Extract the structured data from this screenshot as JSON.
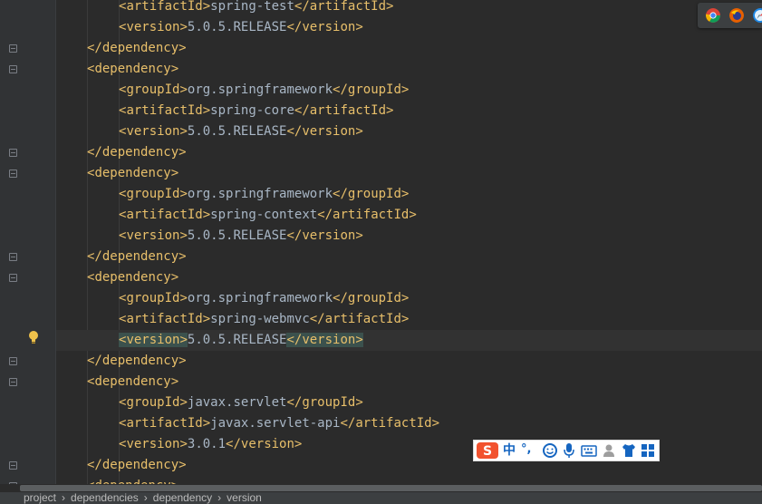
{
  "editor": {
    "lines": [
      {
        "indent": 2,
        "open": "artifactId",
        "text": "spring-test",
        "close": "artifactId"
      },
      {
        "indent": 2,
        "open": "version",
        "text": "5.0.5.RELEASE",
        "close": "version"
      },
      {
        "indent": 1,
        "close_only": "dependency"
      },
      {
        "indent": 1,
        "open_only": "dependency"
      },
      {
        "indent": 2,
        "open": "groupId",
        "text": "org.springframework",
        "close": "groupId"
      },
      {
        "indent": 2,
        "open": "artifactId",
        "text": "spring-core",
        "close": "artifactId"
      },
      {
        "indent": 2,
        "open": "version",
        "text": "5.0.5.RELEASE",
        "close": "version"
      },
      {
        "indent": 1,
        "close_only": "dependency"
      },
      {
        "indent": 1,
        "open_only": "dependency"
      },
      {
        "indent": 2,
        "open": "groupId",
        "text": "org.springframework",
        "close": "groupId"
      },
      {
        "indent": 2,
        "open": "artifactId",
        "text": "spring-context",
        "close": "artifactId"
      },
      {
        "indent": 2,
        "open": "version",
        "text": "5.0.5.RELEASE",
        "close": "version"
      },
      {
        "indent": 1,
        "close_only": "dependency"
      },
      {
        "indent": 1,
        "open_only": "dependency"
      },
      {
        "indent": 2,
        "open": "groupId",
        "text": "org.springframework",
        "close": "groupId"
      },
      {
        "indent": 2,
        "open": "artifactId",
        "text": "spring-webmvc",
        "close": "artifactId"
      },
      {
        "indent": 2,
        "open": "version",
        "text": "5.0.5.RELEASE",
        "close": "version",
        "current": true
      },
      {
        "indent": 1,
        "close_only": "dependency"
      },
      {
        "indent": 1,
        "open_only": "dependency"
      },
      {
        "indent": 2,
        "open": "groupId",
        "text": "javax.servlet",
        "close": "groupId"
      },
      {
        "indent": 2,
        "open": "artifactId",
        "text": "javax.servlet-api",
        "close": "artifactId"
      },
      {
        "indent": 2,
        "open": "version",
        "text": "3.0.1",
        "close": "version"
      },
      {
        "indent": 1,
        "close_only": "dependency"
      },
      {
        "indent": 1,
        "open_only": "dependency"
      }
    ]
  },
  "breadcrumb": [
    "project",
    "dependencies",
    "dependency",
    "version"
  ],
  "breadcrumb_separator": "›",
  "browser_icons": [
    "chrome-icon",
    "firefox-icon",
    "safari-icon"
  ],
  "ime_toolbar": {
    "items": [
      "sogou-logo-icon",
      "中",
      "°,",
      "emoji-icon",
      "microphone-icon",
      "keyboard-icon",
      "user-icon",
      "shirt-icon",
      "grid-icon"
    ]
  },
  "colors": {
    "background": "#2b2b2b",
    "tag": "#e8bf6a",
    "text": "#a9b7c6",
    "current_line": "#323232",
    "gutter": "#313335"
  }
}
